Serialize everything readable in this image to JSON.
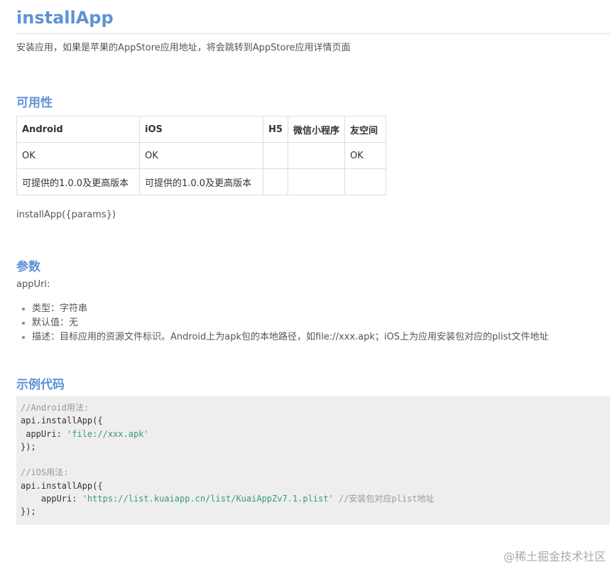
{
  "title": "installApp",
  "description": "安装应用，如果是苹果的AppStore应用地址，将会跳转到AppStore应用详情页面",
  "sections": {
    "availability": "可用性",
    "params": "参数",
    "example": "示例代码"
  },
  "availability_table": {
    "headers": [
      "Android",
      "iOS",
      "H5",
      "微信小程序",
      "友空间"
    ],
    "rows": [
      [
        "OK",
        "OK",
        "",
        "",
        "OK"
      ],
      [
        "可提供的1.0.0及更高版本",
        "可提供的1.0.0及更高版本",
        "",
        "",
        ""
      ]
    ]
  },
  "signature": "installApp({params})",
  "param": {
    "name": "appUri:",
    "items": [
      "类型：字符串",
      "默认值：无",
      "描述：目标应用的资源文件标识。Android上为apk包的本地路径，如file://xxx.apk；iOS上为应用安装包对应的plist文件地址"
    ]
  },
  "code": {
    "android_comment": "//Android用法:",
    "android_call": "api.installApp({",
    "android_key": " appUri: ",
    "android_value": "'file://xxx.apk'",
    "android_close": "});",
    "ios_comment": "//iOS用法:",
    "ios_call": "api.installApp({",
    "ios_key": "    appUri: ",
    "ios_value": "'https://list.kuaiapp.cn/list/KuaiAppZv7.1.plist'",
    "ios_inline_comment": " //安装包对应plist地址",
    "ios_close": "});"
  },
  "watermark": "@稀土掘金技术社区"
}
